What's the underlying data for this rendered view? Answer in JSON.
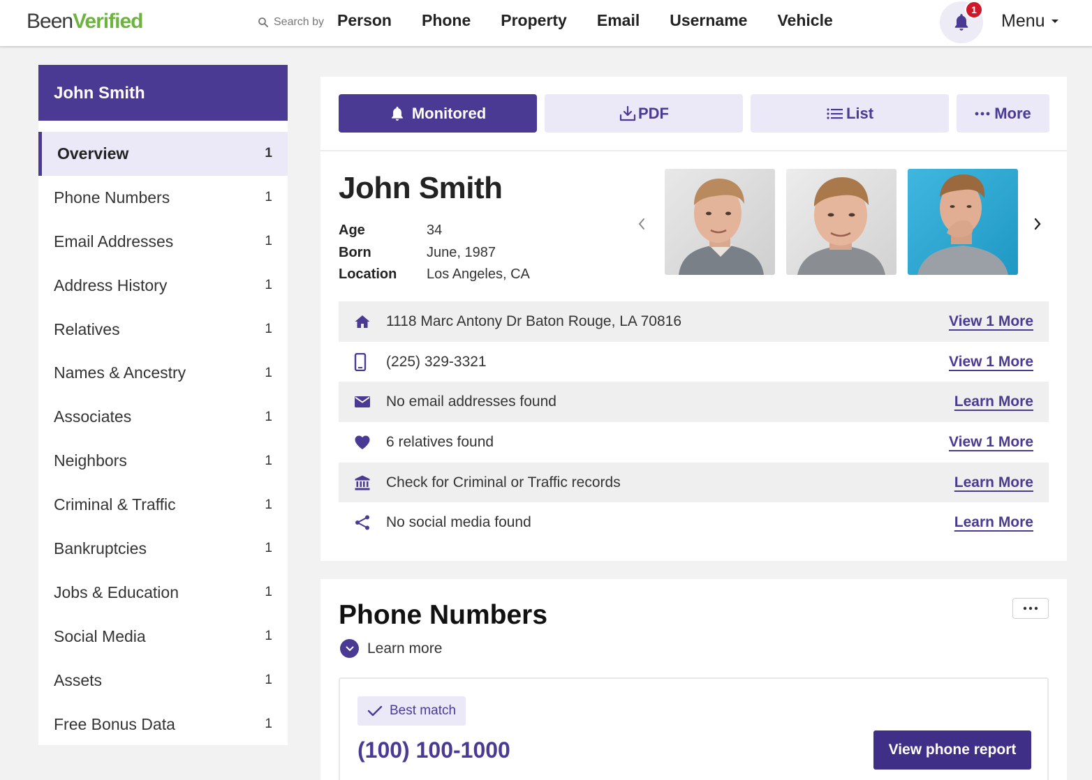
{
  "header": {
    "logo_part1": "Been",
    "logo_part2": "Verified",
    "search_by": "Search by",
    "nav": [
      "Person",
      "Phone",
      "Property",
      "Email",
      "Username",
      "Vehicle"
    ],
    "notification_count": "1",
    "menu_label": "Menu"
  },
  "sidebar": {
    "title": "John Smith",
    "items": [
      {
        "label": "Overview",
        "count": "1"
      },
      {
        "label": "Phone Numbers",
        "count": "1"
      },
      {
        "label": "Email Addresses",
        "count": "1"
      },
      {
        "label": "Address History",
        "count": "1"
      },
      {
        "label": "Relatives",
        "count": "1"
      },
      {
        "label": "Names & Ancestry",
        "count": "1"
      },
      {
        "label": "Associates",
        "count": "1"
      },
      {
        "label": "Neighbors",
        "count": "1"
      },
      {
        "label": "Criminal & Traffic",
        "count": "1"
      },
      {
        "label": "Bankruptcies",
        "count": "1"
      },
      {
        "label": "Jobs & Education",
        "count": "1"
      },
      {
        "label": "Social Media",
        "count": "1"
      },
      {
        "label": "Assets",
        "count": "1"
      },
      {
        "label": "Free Bonus Data",
        "count": "1"
      }
    ]
  },
  "actions": {
    "monitored": "Monitored",
    "pdf": "PDF",
    "list": "List",
    "more": "More"
  },
  "person": {
    "name": "John Smith",
    "facts": [
      {
        "label": "Age",
        "value": "34"
      },
      {
        "label": "Born",
        "value": "June, 1987"
      },
      {
        "label": "Location",
        "value": "Los Angeles, CA"
      }
    ]
  },
  "info_rows": [
    {
      "icon": "home-icon",
      "text": "1118 Marc Antony Dr Baton Rouge, LA 70816",
      "link": "View 1 More"
    },
    {
      "icon": "mobile-phone-icon",
      "text": "(225) 329-3321",
      "link": "View 1 More"
    },
    {
      "icon": "envelope-icon",
      "text": "No email addresses found",
      "link": "Learn More"
    },
    {
      "icon": "heart-icon",
      "text": "6 relatives found",
      "link": "View 1 More"
    },
    {
      "icon": "courthouse-icon",
      "text": "Check for Criminal or Traffic records",
      "link": "Learn More"
    },
    {
      "icon": "share-icon",
      "text": "No social media found",
      "link": "Learn More"
    }
  ],
  "phone_section": {
    "title": "Phone Numbers",
    "learn_more": "Learn more",
    "badge": "Best match",
    "number": "(100) 100-1000",
    "button": "View phone report"
  },
  "colors": {
    "brand_purple": "#4a3a94",
    "brand_green": "#6cb33f",
    "badge_red": "#d0162a"
  }
}
